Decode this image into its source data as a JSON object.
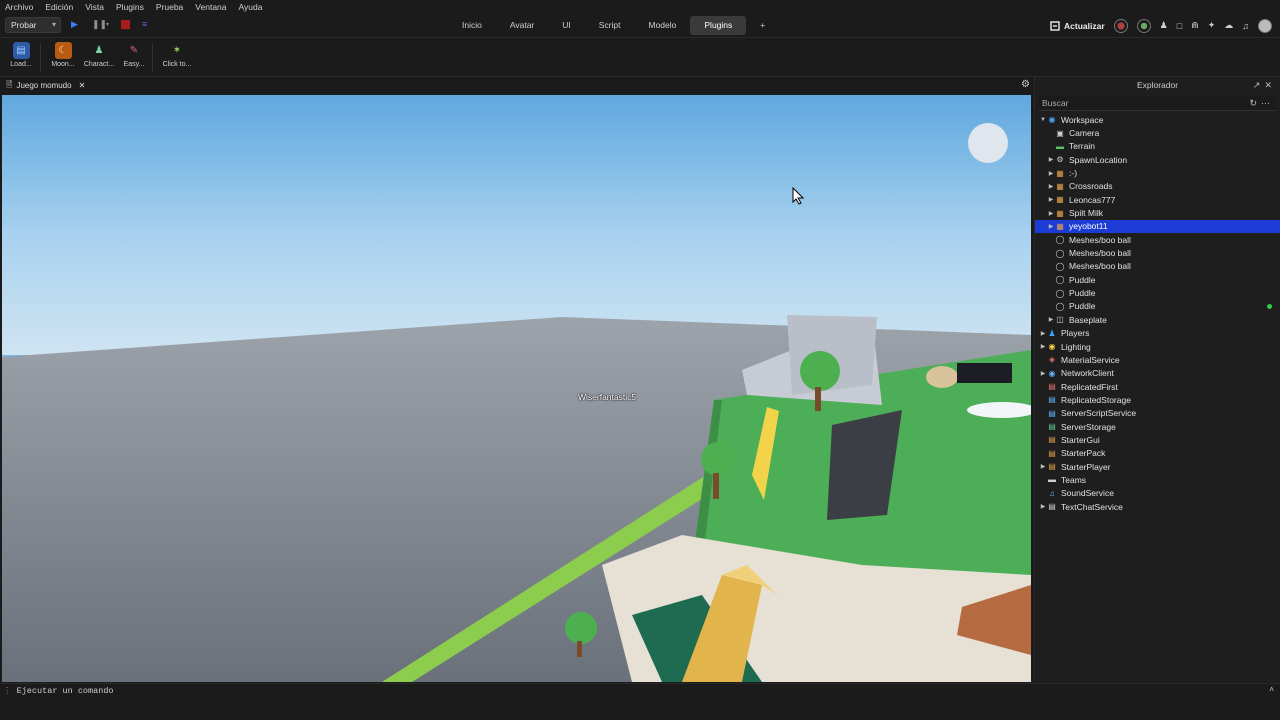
{
  "menu": [
    "Archivo",
    "Edición",
    "Vista",
    "Plugins",
    "Prueba",
    "Ventana",
    "Ayuda"
  ],
  "toolbar": {
    "probar_label": "Probar",
    "tabs": [
      {
        "label": "Inicio",
        "active": false
      },
      {
        "label": "Avatar",
        "active": false
      },
      {
        "label": "UI",
        "active": false
      },
      {
        "label": "Script",
        "active": false
      },
      {
        "label": "Modelo",
        "active": false
      },
      {
        "label": "Plugins",
        "active": true
      },
      {
        "label": "+",
        "active": false
      }
    ],
    "update_label": "Actualizar"
  },
  "ribbon": [
    {
      "label": "Load...",
      "icon": "load-icon"
    },
    {
      "label": "Moon...",
      "icon": "moon-animator-icon"
    },
    {
      "label": "Charact...",
      "icon": "character-icon"
    },
    {
      "label": "Easy...",
      "icon": "brush-icon"
    },
    {
      "label": "Click to...",
      "icon": "plugin-icon"
    }
  ],
  "document_tab": {
    "title": "Juego momudo"
  },
  "viewport": {
    "player_name": "Wiserfantastic5"
  },
  "explorer": {
    "title": "Explorador",
    "search_placeholder": "Buscar",
    "items": [
      {
        "label": "Workspace",
        "icon": "workspace-icon",
        "depth": 0,
        "expander": "expanded"
      },
      {
        "label": "Camera",
        "icon": "camera-icon",
        "depth": 1,
        "expander": "none"
      },
      {
        "label": "Terrain",
        "icon": "terrain-icon",
        "depth": 1,
        "expander": "none"
      },
      {
        "label": "SpawnLocation",
        "icon": "spawn-icon",
        "depth": 1,
        "expander": "collapsed"
      },
      {
        "label": ":-)",
        "icon": "model-icon",
        "depth": 1,
        "expander": "collapsed"
      },
      {
        "label": "Crossroads",
        "icon": "model-icon",
        "depth": 1,
        "expander": "collapsed"
      },
      {
        "label": "Leoncas777",
        "icon": "model-icon",
        "depth": 1,
        "expander": "collapsed"
      },
      {
        "label": "Spilt Milk",
        "icon": "model-icon",
        "depth": 1,
        "expander": "collapsed"
      },
      {
        "label": "yeyobot11",
        "icon": "model-icon",
        "depth": 1,
        "expander": "collapsed",
        "selected": true
      },
      {
        "label": "Meshes/boo ball",
        "icon": "mesh-icon",
        "depth": 1,
        "expander": "none"
      },
      {
        "label": "Meshes/boo ball",
        "icon": "mesh-icon",
        "depth": 1,
        "expander": "none"
      },
      {
        "label": "Meshes/boo ball",
        "icon": "mesh-icon",
        "depth": 1,
        "expander": "none"
      },
      {
        "label": "Puddle",
        "icon": "mesh-icon",
        "depth": 1,
        "expander": "none"
      },
      {
        "label": "Puddle",
        "icon": "mesh-icon",
        "depth": 1,
        "expander": "none"
      },
      {
        "label": "Puddle",
        "icon": "mesh-icon",
        "depth": 1,
        "expander": "none",
        "status_dot": true
      },
      {
        "label": "Baseplate",
        "icon": "part-icon",
        "depth": 1,
        "expander": "collapsed"
      },
      {
        "label": "Players",
        "icon": "players-icon",
        "depth": 0,
        "expander": "collapsed"
      },
      {
        "label": "Lighting",
        "icon": "lighting-icon",
        "depth": 0,
        "expander": "collapsed"
      },
      {
        "label": "MaterialService",
        "icon": "material-service-icon",
        "depth": 0,
        "expander": "none"
      },
      {
        "label": "NetworkClient",
        "icon": "network-icon",
        "depth": 0,
        "expander": "collapsed"
      },
      {
        "label": "ReplicatedFirst",
        "icon": "replicated-first-icon",
        "depth": 0,
        "expander": "none"
      },
      {
        "label": "ReplicatedStorage",
        "icon": "replicated-storage-icon",
        "depth": 0,
        "expander": "none"
      },
      {
        "label": "ServerScriptService",
        "icon": "server-script-icon",
        "depth": 0,
        "expander": "none"
      },
      {
        "label": "ServerStorage",
        "icon": "server-storage-icon",
        "depth": 0,
        "expander": "none"
      },
      {
        "label": "StarterGui",
        "icon": "starter-gui-icon",
        "depth": 0,
        "expander": "none"
      },
      {
        "label": "StarterPack",
        "icon": "starter-pack-icon",
        "depth": 0,
        "expander": "none"
      },
      {
        "label": "StarterPlayer",
        "icon": "starter-player-icon",
        "depth": 0,
        "expander": "collapsed"
      },
      {
        "label": "Teams",
        "icon": "teams-icon",
        "depth": 0,
        "expander": "none"
      },
      {
        "label": "SoundService",
        "icon": "sound-icon",
        "depth": 0,
        "expander": "none"
      },
      {
        "label": "TextChatService",
        "icon": "text-chat-icon",
        "depth": 0,
        "expander": "collapsed"
      }
    ]
  },
  "command_bar": {
    "placeholder": "Ejecutar un comando"
  },
  "colors": {
    "selection": "#1d3cd6",
    "accent": "#3a3a3a",
    "status_green": "#2ecc40"
  }
}
